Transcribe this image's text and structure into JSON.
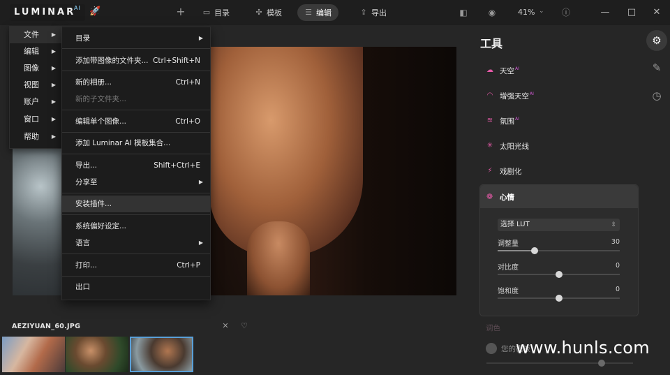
{
  "app": {
    "logo_text": "LUMINAR",
    "logo_sup": "AI",
    "rocket_icon": "rocket-icon"
  },
  "toolbar": {
    "add_icon": "plus-icon",
    "catalog_label": "目录",
    "templates_label": "模板",
    "edit_label": "编辑",
    "export_label": "导出",
    "zoom_value": "41%",
    "icons": [
      "compare-icon",
      "eye-icon",
      "help-icon"
    ]
  },
  "window_controls": {
    "minimize": "—",
    "maximize": "□",
    "close": "✕"
  },
  "main_menu": {
    "items": [
      {
        "label": "文件",
        "highlighted": true
      },
      {
        "label": "编辑"
      },
      {
        "label": "图像"
      },
      {
        "label": "视图"
      },
      {
        "label": "账户"
      },
      {
        "label": "窗口"
      },
      {
        "label": "帮助"
      }
    ]
  },
  "file_submenu": {
    "items": [
      {
        "label": "目录",
        "shortcut": "",
        "has_arrow": true
      },
      {
        "label": "添加带图像的文件夹...",
        "shortcut": "Ctrl+Shift+N"
      },
      {
        "label": "新的相册...",
        "shortcut": "Ctrl+N"
      },
      {
        "label": "新的子文件夹...",
        "shortcut": "",
        "disabled": true
      },
      {
        "label": "编辑单个图像...",
        "shortcut": "Ctrl+O"
      },
      {
        "label": "添加 Luminar AI 模板集合...",
        "shortcut": ""
      },
      {
        "label": "导出...",
        "shortcut": "Shift+Ctrl+E"
      },
      {
        "label": "分享至",
        "shortcut": "",
        "has_arrow": true
      },
      {
        "label": "安装插件...",
        "shortcut": "",
        "highlighted": true
      },
      {
        "label": "系统偏好设定...",
        "shortcut": ""
      },
      {
        "label": "语言",
        "shortcut": "",
        "has_arrow": true
      },
      {
        "label": "打印...",
        "shortcut": "Ctrl+P"
      },
      {
        "label": "出口",
        "shortcut": ""
      }
    ]
  },
  "tools_panel": {
    "title": "工具",
    "ai_tag": "AI",
    "tools": [
      {
        "label": "天空",
        "ai": true,
        "icon": "cloud-icon"
      },
      {
        "label": "增强天空",
        "ai": true,
        "icon": "rainbow-icon"
      },
      {
        "label": "氛围",
        "ai": true,
        "icon": "waves-icon"
      },
      {
        "label": "太阳光线",
        "ai": false,
        "icon": "sun-icon"
      },
      {
        "label": "戏剧化",
        "ai": false,
        "icon": "lightning-icon"
      }
    ],
    "mood": {
      "label": "心情",
      "icon": "mood-icon",
      "lut_placeholder": "选择 LUT",
      "sliders": [
        {
          "label": "调整量",
          "value": 30,
          "min": 0,
          "max": 100
        },
        {
          "label": "对比度",
          "value": 0,
          "min": -100,
          "max": 100
        },
        {
          "label": "饱和度",
          "value": 0,
          "min": -100,
          "max": 100
        }
      ]
    },
    "faded_tool": "调色",
    "toggle_label": "您的模板"
  },
  "side_icons": [
    "sliders-icon",
    "brush-icon",
    "history-icon"
  ],
  "filmstrip": {
    "filename": "AEZIYUAN_60.JPG",
    "icons": [
      "close-icon",
      "heart-icon"
    ],
    "thumbnail_count": 3,
    "selected_index": 2
  },
  "watermark": "www.hunls.com",
  "colors": {
    "accent_pink": "#e65aa8",
    "selection_blue": "#5aa0d8",
    "background": "#262626"
  }
}
